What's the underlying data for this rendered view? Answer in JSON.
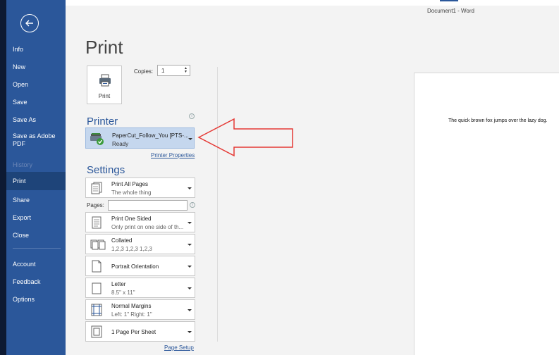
{
  "window": {
    "title": "Document1  -  Word"
  },
  "sidebar": {
    "items": [
      {
        "label": "Info"
      },
      {
        "label": "New"
      },
      {
        "label": "Open"
      },
      {
        "label": "Save"
      },
      {
        "label": "Save As"
      },
      {
        "label": "Save as Adobe PDF"
      },
      {
        "label": "History"
      },
      {
        "label": "Print"
      },
      {
        "label": "Share"
      },
      {
        "label": "Export"
      },
      {
        "label": "Close"
      },
      {
        "label": "Account"
      },
      {
        "label": "Feedback"
      },
      {
        "label": "Options"
      }
    ],
    "selected": "Print"
  },
  "print": {
    "title": "Print",
    "button_label": "Print",
    "copies_label": "Copies:",
    "copies_value": "1"
  },
  "printer": {
    "section_title": "Printer",
    "name": "PaperCut_Follow_You [PTS-...",
    "status": "Ready",
    "properties_link": "Printer Properties"
  },
  "settings": {
    "section_title": "Settings",
    "pages_label": "Pages:",
    "pages_value": "",
    "items": [
      {
        "primary": "Print All Pages",
        "secondary": "The whole thing"
      },
      {
        "primary": "Print One Sided",
        "secondary": "Only print on one side of th..."
      },
      {
        "primary": "Collated",
        "secondary": "1,2,3   1,2,3   1,2,3"
      },
      {
        "primary": "Portrait Orientation",
        "secondary": ""
      },
      {
        "primary": "Letter",
        "secondary": "8.5\" x 11\""
      },
      {
        "primary": "Normal Margins",
        "secondary": "Left:  1\"    Right:  1\""
      },
      {
        "primary": "1 Page Per Sheet",
        "secondary": ""
      }
    ],
    "page_setup_link": "Page Setup"
  },
  "preview": {
    "text": "The quick brown fox jumps over the lazy dog."
  },
  "colors": {
    "sidebar": "#2b579a",
    "sidebar_selected": "#1e4479",
    "accent": "#2b579a",
    "arrow": "#e53935"
  },
  "icons": {
    "back": "back-arrow-icon",
    "printer": "printer-icon",
    "printer_status": "printer-ready-icon",
    "info": "info-icon",
    "settings": [
      "pages-icon",
      "one-sided-icon",
      "collated-icon",
      "portrait-icon",
      "letter-icon",
      "margins-icon",
      "pages-per-sheet-icon"
    ]
  }
}
